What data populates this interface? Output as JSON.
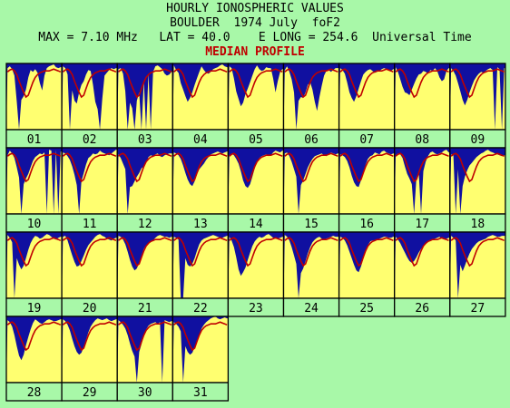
{
  "header": {
    "line1": "HOURLY IONOSPHERIC VALUES",
    "line2": "BOULDER  1974 July  foF2",
    "line3": "MAX = 7.10 MHz   LAT = 40.0    E LONG = 254.6  Universal Time",
    "line4": "MEDIAN PROFILE"
  },
  "colors": {
    "background": "#a8f8a8",
    "sky": "#1010a0",
    "fill": "#ffff70",
    "median": "#c00000",
    "grid": "#000000"
  },
  "chart_data": {
    "type": "area",
    "title": "HOURLY IONOSPHERIC VALUES",
    "subtitle": "BOULDER  1974 July  foF2",
    "max_mhz": 7.1,
    "hours_per_day": 24,
    "days": [
      "01",
      "02",
      "03",
      "04",
      "05",
      "06",
      "07",
      "08",
      "09",
      "10",
      "11",
      "12",
      "13",
      "14",
      "15",
      "16",
      "17",
      "18",
      "19",
      "20",
      "21",
      "22",
      "23",
      "24",
      "25",
      "26",
      "27",
      "28",
      "29",
      "30",
      "31"
    ],
    "median_profile": [
      6.2,
      6.4,
      6.5,
      6.3,
      5.9,
      5.2,
      4.6,
      4.0,
      3.5,
      3.7,
      4.4,
      5.1,
      5.6,
      5.9,
      6.1,
      6.2,
      6.3,
      6.3,
      6.3,
      6.4,
      6.5,
      6.4,
      6.3,
      6.2
    ],
    "series": [
      {
        "day": "01",
        "values": [
          6.6,
          6.8,
          6.5,
          5.8,
          3.0,
          0,
          3.2,
          3.6,
          4.3,
          5.6,
          6.4,
          6.2,
          6.5,
          6.1,
          5.0,
          4.2,
          5.8,
          6.6,
          6.8,
          6.9,
          7.0,
          6.7,
          6.6,
          6.7
        ]
      },
      {
        "day": "02",
        "values": [
          6.8,
          6.6,
          5.9,
          0,
          4.2,
          3.1,
          2.8,
          4.0,
          4.8,
          5.2,
          5.9,
          6.4,
          6.3,
          4.8,
          3.0,
          2.2,
          0,
          3.3,
          5.8,
          6.1,
          6.4,
          6.6,
          6.5,
          6.6
        ]
      },
      {
        "day": "03",
        "values": [
          6.5,
          6.6,
          6.0,
          4.1,
          0,
          2.9,
          2.3,
          0,
          3.1,
          4.0,
          0,
          5.2,
          0,
          6.0,
          0,
          6.2,
          6.8,
          6.9,
          6.7,
          6.5,
          6.0,
          5.8,
          5.9,
          6.2
        ]
      },
      {
        "day": "04",
        "values": [
          6.9,
          6.4,
          6.1,
          5.0,
          4.3,
          3.6,
          3.0,
          3.4,
          4.0,
          4.8,
          5.5,
          6.2,
          6.8,
          6.4,
          6.1,
          6.0,
          6.2,
          6.5,
          6.6,
          6.7,
          6.9,
          7.0,
          6.8,
          6.7
        ]
      },
      {
        "day": "05",
        "values": [
          6.8,
          6.6,
          5.5,
          4.1,
          3.3,
          2.5,
          2.9,
          3.8,
          4.4,
          5.1,
          5.8,
          6.5,
          6.9,
          6.5,
          6.3,
          6.4,
          6.7,
          6.6,
          6.6,
          5.5,
          4.0,
          5.2,
          6.2,
          6.5
        ]
      },
      {
        "day": "06",
        "values": [
          6.4,
          6.8,
          6.2,
          5.4,
          4.0,
          0,
          3.1,
          3.5,
          3.4,
          4.0,
          4.8,
          5.1,
          4.3,
          3.0,
          2.0,
          3.5,
          4.7,
          5.8,
          6.3,
          6.4,
          6.2,
          6.4,
          6.6,
          6.6
        ]
      },
      {
        "day": "07",
        "values": [
          6.6,
          6.4,
          6.0,
          5.1,
          4.0,
          3.4,
          3.0,
          3.6,
          4.4,
          5.2,
          5.9,
          6.2,
          6.4,
          6.5,
          6.3,
          6.1,
          6.2,
          6.3,
          6.5,
          6.6,
          6.5,
          6.4,
          6.3,
          6.5
        ]
      },
      {
        "day": "08",
        "values": [
          6.7,
          6.2,
          5.4,
          4.6,
          4.0,
          3.9,
          3.7,
          4.3,
          4.9,
          5.5,
          5.9,
          6.0,
          6.3,
          6.2,
          6.0,
          6.4,
          6.3,
          6.6,
          6.3,
          5.6,
          5.2,
          5.4,
          6.3,
          6.6
        ]
      },
      {
        "day": "09",
        "values": [
          6.6,
          6.3,
          5.8,
          5.0,
          4.1,
          3.2,
          2.6,
          3.2,
          4.0,
          4.7,
          5.3,
          5.7,
          6.0,
          6.2,
          6.1,
          6.3,
          6.5,
          6.6,
          6.4,
          0,
          6.7,
          6.5,
          0,
          6.6
        ]
      },
      {
        "day": "10",
        "values": [
          6.3,
          6.8,
          6.5,
          6.0,
          5.0,
          3.9,
          0,
          3.2,
          3.8,
          4.3,
          5.0,
          5.7,
          6.1,
          6.3,
          6.5,
          6.4,
          6.6,
          0,
          6.9,
          6.8,
          0,
          6.9,
          0,
          6.7
        ]
      },
      {
        "day": "11",
        "values": [
          6.6,
          6.5,
          6.2,
          5.8,
          5.1,
          4.2,
          3.1,
          0,
          3.5,
          4.4,
          5.3,
          6.0,
          6.2,
          6.5,
          6.4,
          6.5,
          6.8,
          6.6,
          6.5,
          6.4,
          6.3,
          6.5,
          6.7,
          6.9
        ]
      },
      {
        "day": "12",
        "values": [
          6.4,
          6.0,
          5.4,
          4.8,
          0,
          2.9,
          3.0,
          3.5,
          4.0,
          4.4,
          4.9,
          5.1,
          5.5,
          6.1,
          6.3,
          6.2,
          6.4,
          6.5,
          6.2,
          6.1,
          6.3,
          6.4,
          6.5,
          6.5
        ]
      },
      {
        "day": "13",
        "values": [
          6.6,
          6.5,
          6.3,
          5.9,
          5.2,
          4.4,
          3.7,
          3.2,
          3.0,
          3.5,
          4.2,
          4.8,
          5.1,
          5.4,
          5.8,
          6.1,
          6.4,
          6.5,
          6.6,
          6.7,
          6.6,
          6.5,
          6.6,
          6.7
        ]
      },
      {
        "day": "14",
        "values": [
          6.2,
          6.5,
          6.3,
          5.9,
          5.4,
          4.6,
          3.6,
          3.0,
          2.8,
          3.2,
          4.0,
          4.9,
          5.6,
          6.0,
          6.2,
          6.3,
          6.4,
          6.2,
          6.3,
          6.6,
          6.8,
          6.7,
          6.6,
          6.8
        ]
      },
      {
        "day": "15",
        "values": [
          6.5,
          6.6,
          6.2,
          5.6,
          4.8,
          4.0,
          0,
          3.1,
          3.6,
          4.3,
          5.0,
          5.5,
          5.9,
          6.2,
          6.3,
          6.4,
          6.5,
          6.3,
          6.2,
          6.4,
          6.6,
          6.5,
          6.4,
          6.5
        ]
      },
      {
        "day": "16",
        "values": [
          6.4,
          6.3,
          6.1,
          5.7,
          5.0,
          4.1,
          3.4,
          3.0,
          2.9,
          3.6,
          4.5,
          5.3,
          5.9,
          6.2,
          6.3,
          6.6,
          6.5,
          6.4,
          6.7,
          6.8,
          6.6,
          6.5,
          6.4,
          6.5
        ]
      },
      {
        "day": "17",
        "values": [
          6.3,
          6.5,
          6.4,
          6.0,
          5.1,
          4.3,
          3.8,
          3.2,
          0,
          3.9,
          4.5,
          0,
          4.6,
          5.6,
          6.2,
          6.6,
          6.7,
          6.5,
          6.4,
          6.5,
          6.6,
          6.8,
          6.9,
          6.6
        ]
      },
      {
        "day": "18",
        "values": [
          6.4,
          6.3,
          0,
          4.8,
          0,
          3.0,
          4.0,
          4.7,
          5.2,
          5.5,
          5.8,
          6.1,
          6.3,
          6.5,
          6.6,
          6.8,
          6.9,
          6.7,
          6.6,
          6.5,
          6.4,
          6.3,
          6.2,
          6.3
        ]
      },
      {
        "day": "19",
        "values": [
          6.8,
          6.5,
          6.0,
          0,
          4.3,
          3.6,
          3.1,
          3.5,
          4.3,
          5.2,
          5.9,
          6.4,
          6.7,
          6.6,
          6.4,
          6.5,
          6.7,
          6.9,
          6.8,
          6.6,
          6.4,
          6.3,
          6.5,
          6.6
        ]
      },
      {
        "day": "20",
        "values": [
          6.6,
          6.7,
          6.2,
          5.4,
          4.6,
          3.9,
          3.4,
          3.5,
          4.0,
          4.6,
          5.2,
          5.7,
          6.0,
          6.3,
          6.6,
          6.8,
          6.9,
          6.7,
          6.6,
          6.4,
          6.3,
          6.2,
          6.4,
          6.5
        ]
      },
      {
        "day": "21",
        "values": [
          6.7,
          6.6,
          6.3,
          5.8,
          5.0,
          4.1,
          3.4,
          3.0,
          3.2,
          3.8,
          4.6,
          5.3,
          5.7,
          5.9,
          6.0,
          6.2,
          6.5,
          6.7,
          6.8,
          6.7,
          6.6,
          6.6,
          6.5,
          6.6
        ]
      },
      {
        "day": "22",
        "values": [
          6.6,
          6.5,
          6.3,
          0,
          0,
          4.3,
          3.6,
          3.4,
          3.7,
          4.3,
          5.1,
          5.8,
          6.2,
          6.4,
          6.5,
          6.6,
          6.7,
          6.8,
          6.7,
          6.6,
          6.5,
          6.5,
          6.6,
          6.7
        ]
      },
      {
        "day": "23",
        "values": [
          6.6,
          6.2,
          5.5,
          4.4,
          3.1,
          2.4,
          2.8,
          3.3,
          4.1,
          4.9,
          5.6,
          6.1,
          6.4,
          6.6,
          6.5,
          6.6,
          6.8,
          6.9,
          6.7,
          6.5,
          6.4,
          6.4,
          6.5,
          6.6
        ]
      },
      {
        "day": "24",
        "values": [
          6.8,
          6.6,
          6.2,
          5.5,
          4.6,
          3.7,
          0,
          2.7,
          3.2,
          4.0,
          4.8,
          5.5,
          6.0,
          6.3,
          6.5,
          6.6,
          6.4,
          6.3,
          6.4,
          6.5,
          6.6,
          6.7,
          6.6,
          6.6
        ]
      },
      {
        "day": "25",
        "values": [
          6.6,
          6.5,
          6.2,
          5.7,
          5.0,
          4.3,
          3.6,
          3.0,
          2.8,
          3.4,
          4.2,
          5.0,
          5.7,
          6.1,
          6.2,
          6.2,
          6.3,
          6.4,
          6.5,
          6.6,
          6.6,
          6.5,
          6.5,
          6.6
        ]
      },
      {
        "day": "26",
        "values": [
          6.6,
          6.3,
          5.9,
          5.4,
          4.9,
          4.4,
          4.0,
          3.8,
          4.0,
          4.4,
          4.9,
          5.3,
          5.6,
          5.8,
          6.0,
          6.2,
          6.3,
          6.4,
          6.5,
          6.6,
          6.4,
          6.3,
          6.4,
          6.5
        ]
      },
      {
        "day": "27",
        "values": [
          6.7,
          6.5,
          6.2,
          0,
          3.6,
          2.9,
          3.5,
          4.2,
          4.8,
          5.3,
          5.6,
          5.9,
          6.1,
          6.2,
          6.3,
          6.4,
          6.6,
          6.7,
          6.8,
          6.7,
          6.6,
          6.6,
          6.7,
          6.7
        ]
      },
      {
        "day": "28",
        "values": [
          6.7,
          6.5,
          6.0,
          5.1,
          3.9,
          2.9,
          2.4,
          3.0,
          4.0,
          4.9,
          5.7,
          6.4,
          6.8,
          6.6,
          6.4,
          6.3,
          6.5,
          6.7,
          6.8,
          6.7,
          6.6,
          6.6,
          6.7,
          6.8
        ]
      },
      {
        "day": "29",
        "values": [
          6.8,
          6.6,
          6.2,
          5.6,
          4.7,
          3.9,
          3.3,
          3.0,
          3.2,
          3.8,
          4.6,
          5.4,
          6.0,
          6.4,
          6.7,
          6.9,
          6.8,
          6.7,
          6.8,
          6.9,
          6.7,
          6.6,
          6.7,
          6.8
        ]
      },
      {
        "day": "30",
        "values": [
          6.7,
          6.5,
          6.2,
          5.8,
          5.1,
          4.2,
          3.4,
          2.8,
          0,
          3.3,
          4.1,
          5.0,
          5.7,
          6.1,
          6.3,
          6.4,
          6.5,
          6.3,
          6.5,
          0,
          6.7,
          6.6,
          6.5,
          6.6
        ]
      },
      {
        "day": "31",
        "values": [
          6.5,
          6.3,
          6.0,
          5.5,
          0,
          3.9,
          3.3,
          3.0,
          3.2,
          3.8,
          4.5,
          5.2,
          5.8,
          6.2,
          6.5,
          6.7,
          6.9,
          7.0,
          7.1,
          6.9,
          6.8,
          6.9,
          7.0,
          6.9
        ]
      }
    ]
  }
}
